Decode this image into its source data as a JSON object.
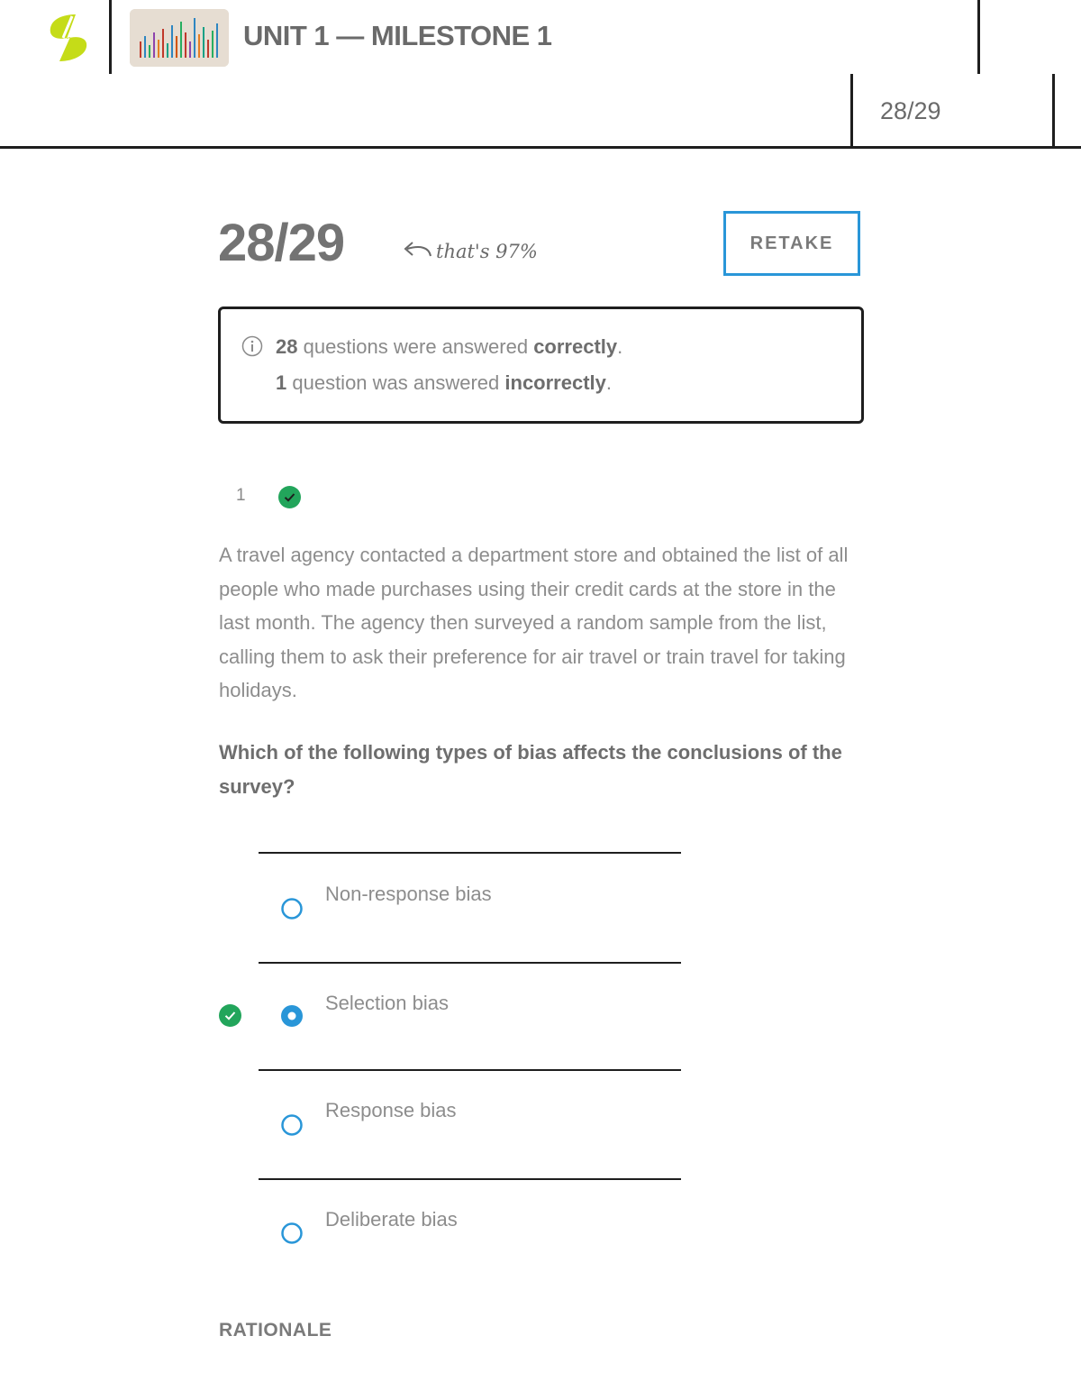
{
  "header": {
    "course_title": "UNIT 1 — MILESTONE 1",
    "score": "28/29"
  },
  "score_section": {
    "score": "28/29",
    "annotation": "that's 97%",
    "retake_label": "RETAKE"
  },
  "summary": {
    "correct_count": "28",
    "correct_text": " questions were answered ",
    "correct_word": "correctly",
    "incorrect_count": "1",
    "incorrect_text": " question was answered ",
    "incorrect_word": "incorrectly",
    "period": "."
  },
  "question": {
    "number": "1",
    "status": "correct",
    "text": "A travel agency contacted a department store and obtained the list of all people who made purchases using their credit cards at the store in the last month. The agency then surveyed a random sample from the list, calling them to ask their preference for air travel or train travel for taking holidays.",
    "prompt": "Which of the following types of bias affects the conclusions of the survey?",
    "options": [
      {
        "label": "Non-response bias",
        "selected": false
      },
      {
        "label": "Selection bias",
        "selected": true,
        "marked_correct": true
      },
      {
        "label": "Response bias",
        "selected": false
      },
      {
        "label": "Deliberate bias",
        "selected": false
      }
    ],
    "rationale_heading": "RATIONALE"
  },
  "colors": {
    "accent_blue": "#2996d8",
    "correct_green": "#22a55b",
    "logo_lime": "#c5dc18"
  }
}
